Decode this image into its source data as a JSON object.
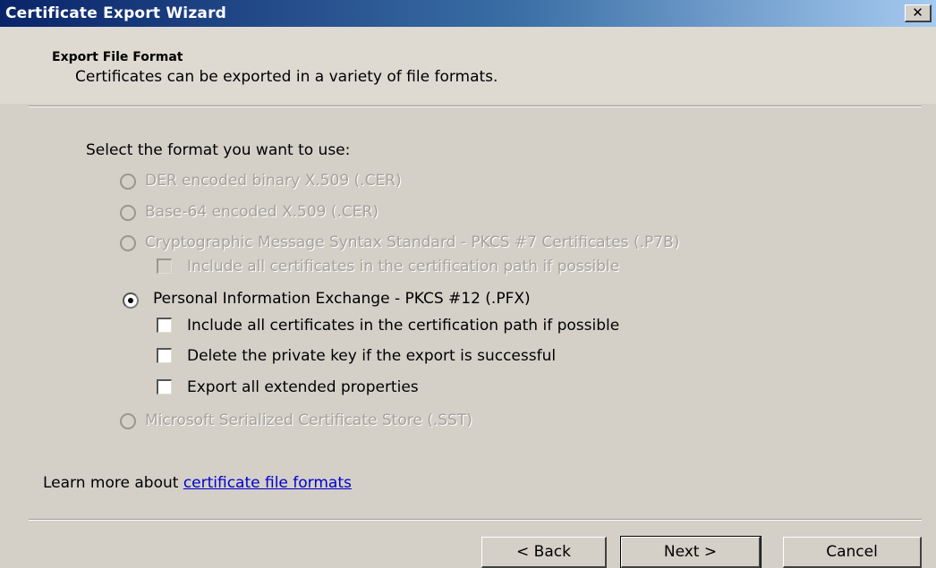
{
  "window": {
    "title": "Certificate Export Wizard",
    "close_glyph": "✕"
  },
  "header": {
    "title": "Export File Format",
    "subtitle": "Certificates can be exported in a variety of file formats."
  },
  "main": {
    "prompt": "Select the format you want to use:",
    "options": [
      {
        "label": "DER encoded binary X.509 (.CER)",
        "enabled": false,
        "selected": false
      },
      {
        "label": "Base-64 encoded X.509 (.CER)",
        "enabled": false,
        "selected": false
      },
      {
        "label": "Cryptographic Message Syntax Standard - PKCS #7 Certificates (.P7B)",
        "enabled": false,
        "selected": false
      },
      {
        "label": "Personal Information Exchange - PKCS #12 (.PFX)",
        "enabled": true,
        "selected": true
      },
      {
        "label": "Microsoft Serialized Certificate Store (.SST)",
        "enabled": false,
        "selected": false
      }
    ],
    "p7b_checkbox": {
      "label": "Include all certificates in the certification path if possible",
      "enabled": false,
      "checked": false
    },
    "pfx_checkboxes": [
      {
        "label": "Include all certificates in the certification path if possible",
        "enabled": true,
        "checked": false
      },
      {
        "label": "Delete the private key if the export is successful",
        "enabled": true,
        "checked": false
      },
      {
        "label": "Export all extended properties",
        "enabled": true,
        "checked": false
      }
    ]
  },
  "learn_more": {
    "prefix": "Learn more about ",
    "link": "certificate file formats"
  },
  "buttons": {
    "back": "< Back",
    "next": "Next >",
    "cancel": "Cancel"
  }
}
